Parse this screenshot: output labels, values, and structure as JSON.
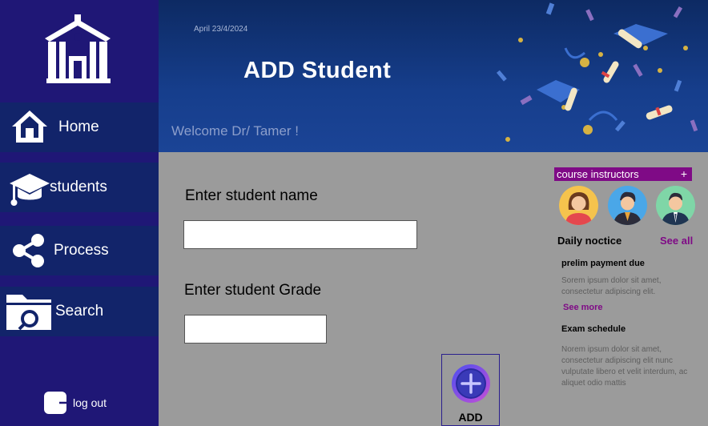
{
  "sidebar": {
    "logo_icon": "school-building-icon",
    "items": [
      {
        "label": "Home",
        "icon": "house-icon"
      },
      {
        "label": "students",
        "icon": "graduation-cap-icon"
      },
      {
        "label": "Process",
        "icon": "share-nodes-icon"
      },
      {
        "label": "Search",
        "icon": "folder-search-icon"
      }
    ],
    "logout": {
      "label": "log out",
      "icon": "logout-icon"
    }
  },
  "banner": {
    "date": "April 23/4/2024",
    "title": "ADD Student",
    "welcome": "Welcome Dr/ Tamer !"
  },
  "form": {
    "name_label": "Enter student name",
    "name_value": "",
    "grade_label": "Enter student Grade",
    "grade_value": "",
    "add_label": "ADD"
  },
  "panel": {
    "instructors_title": "course instructors",
    "instructors_add": "+",
    "daily_title": "Daily noctice",
    "see_all": "See all",
    "notices": [
      {
        "title": "prelim payment due",
        "body": "Sorem ipsum dolor sit amet, consectetur adipiscing elit."
      },
      {
        "title": "Exam schedule",
        "body": "Norem ipsum dolor sit amet, consectetur adipiscing elit nunc vulputate libero et velit interdum, ac aliquet odio mattis"
      }
    ],
    "see_more": "See more"
  },
  "colors": {
    "sidebar": "#1f1776",
    "nav_item": "#12246a",
    "accent": "#7f0a86",
    "content_bg": "#9b9b9b"
  }
}
